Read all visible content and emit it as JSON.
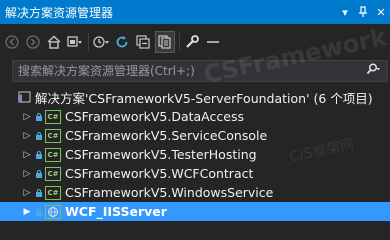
{
  "titlebar": {
    "title": "解决方案资源管理器",
    "buttons": [
      "dropdown-icon",
      "pin-icon",
      "close-icon"
    ]
  },
  "toolbar": {
    "icons": [
      "back-icon",
      "forward-icon",
      "home-icon",
      "switch-views-icon",
      "history-icon",
      "refresh-icon",
      "collapse-all-icon",
      "show-all-files-icon",
      "properties-icon",
      "preview-icon"
    ]
  },
  "search": {
    "placeholder": "搜索解决方案资源管理器(Ctrl+;)"
  },
  "tree": {
    "solution_label": "解决方案'CSFrameworkV5-ServerFoundation' (6 个项目)",
    "projects": [
      {
        "label": "CSFrameworkV5.DataAccess",
        "type": "csharp"
      },
      {
        "label": "CSFrameworkV5.ServiceConsole",
        "type": "csharp"
      },
      {
        "label": "CSFrameworkV5.TesterHosting",
        "type": "csharp"
      },
      {
        "label": "CSFrameworkV5.WCFContract",
        "type": "csharp"
      },
      {
        "label": "CSFrameworkV5.WindowsService",
        "type": "csharp"
      },
      {
        "label": "WCF_IISServer",
        "type": "web",
        "selected": true
      }
    ]
  },
  "watermark": {
    "text1": "CSFramework",
    "text2": "C/S框架网"
  },
  "colors": {
    "accent": "#007acc",
    "selection": "#3399ff",
    "background": "#252526"
  }
}
